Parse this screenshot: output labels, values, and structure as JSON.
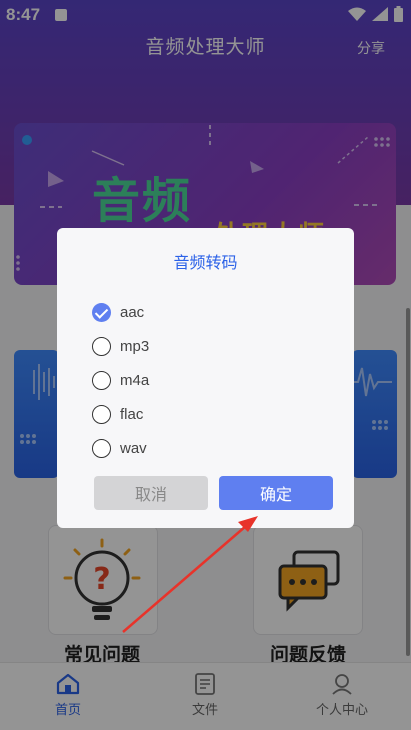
{
  "status_bar": {
    "time": "8:47"
  },
  "header": {
    "title": "音频处理大师",
    "share": "分享"
  },
  "banner": {
    "title": "音频",
    "subtitle": "处理大师"
  },
  "help": {
    "faq_label": "常见问题",
    "feedback_label": "问题反馈"
  },
  "bottom_nav": [
    {
      "label": "首页",
      "active": true
    },
    {
      "label": "文件",
      "active": false
    },
    {
      "label": "个人中心",
      "active": false
    }
  ],
  "dialog": {
    "title": "音频转码",
    "options": [
      {
        "label": "aac",
        "checked": true
      },
      {
        "label": "mp3",
        "checked": false
      },
      {
        "label": "m4a",
        "checked": false
      },
      {
        "label": "flac",
        "checked": false
      },
      {
        "label": "wav",
        "checked": false
      }
    ],
    "cancel_label": "取消",
    "confirm_label": "确定"
  },
  "colors": {
    "accent": "#2c62e8",
    "confirm": "#5f7ff0",
    "annotation_arrow": "#e8332a"
  }
}
